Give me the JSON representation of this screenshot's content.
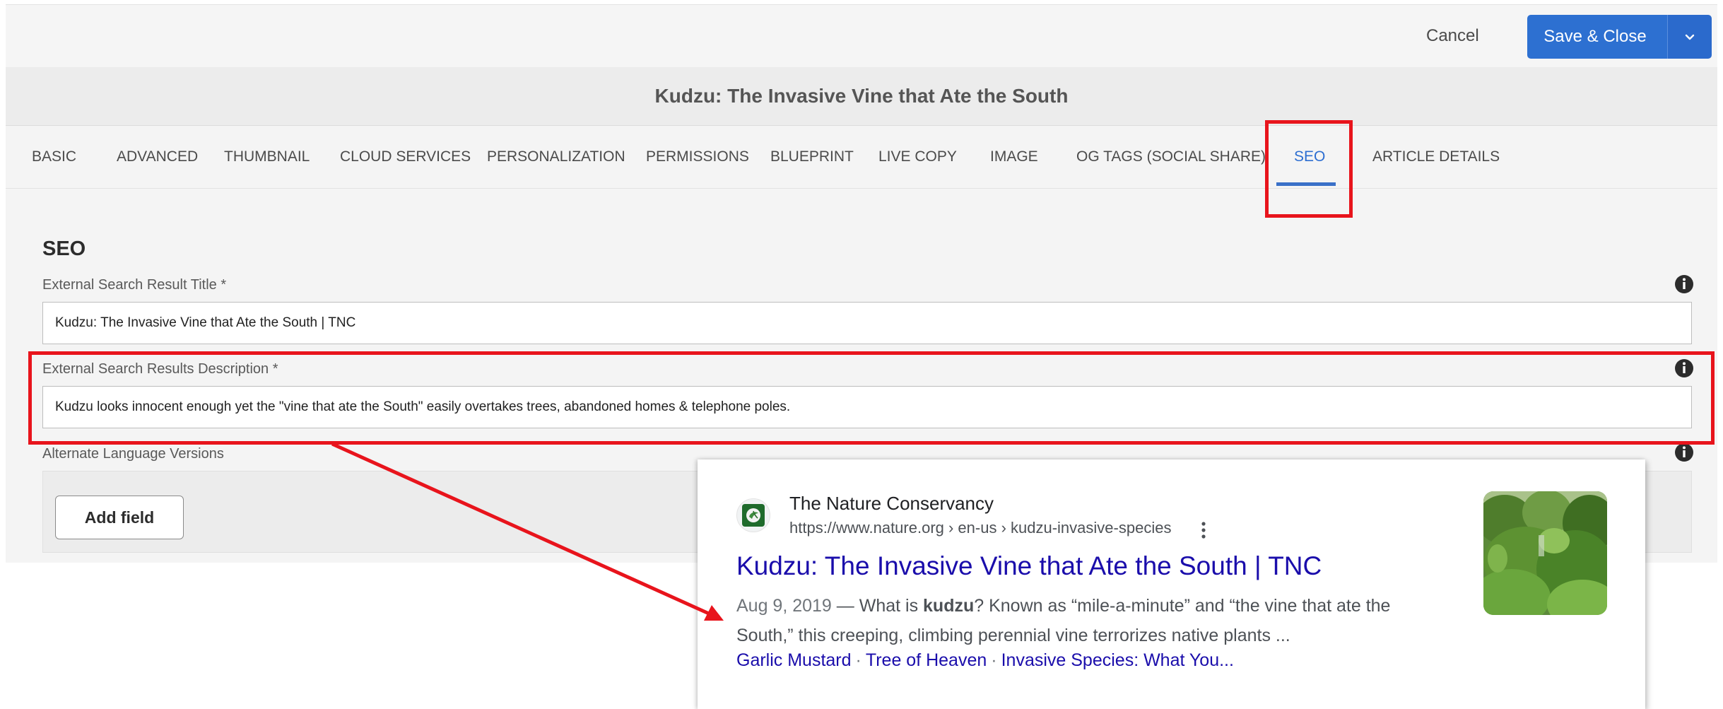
{
  "toolbar": {
    "cancel_label": "Cancel",
    "save_label": "Save & Close"
  },
  "page_title": "Kudzu: The Invasive Vine that Ate the South",
  "tabs": [
    {
      "label": "BASIC"
    },
    {
      "label": "ADVANCED"
    },
    {
      "label": "THUMBNAIL"
    },
    {
      "label": "CLOUD SERVICES"
    },
    {
      "label": "PERSONALIZATION"
    },
    {
      "label": "PERMISSIONS"
    },
    {
      "label": "BLUEPRINT"
    },
    {
      "label": "LIVE COPY"
    },
    {
      "label": "IMAGE"
    },
    {
      "label": "OG TAGS (SOCIAL SHARE)"
    },
    {
      "label": "SEO",
      "active": true
    },
    {
      "label": "ARTICLE DETAILS"
    }
  ],
  "section": {
    "title": "SEO",
    "fields": [
      {
        "label": "External Search Result Title *",
        "value": "Kudzu: The Invasive Vine that Ate the South | TNC"
      },
      {
        "label": "External Search Results Description *",
        "value": "Kudzu looks innocent enough yet the \"vine that ate the South\" easily overtakes trees, abandoned homes & telephone poles."
      }
    ],
    "alt_lang_label": "Alternate Language Versions",
    "add_field_label": "Add field"
  },
  "serp": {
    "site_name": "The Nature Conservancy",
    "url": "https://www.nature.org › en-us › kudzu-invasive-species",
    "title": "Kudzu: The Invasive Vine that Ate the South | TNC",
    "date": "Aug 9, 2019",
    "snippet_prefix": " — What is ",
    "snippet_bold": "kudzu",
    "snippet_suffix": "? Known as “mile-a-minute” and “the vine that ate the South,” this creeping, climbing perennial vine terrorizes native plants ...",
    "sitelinks": [
      "Garlic Mustard",
      "Tree of Heaven",
      "Invasive Species: What You..."
    ],
    "separator": "·"
  },
  "colors": {
    "accent": "#2d70d1",
    "highlight": "#e8141c",
    "link": "#1a0dab"
  },
  "icons": [
    "chevron-down-icon",
    "info-icon",
    "more-vert-icon",
    "favicon-icon"
  ]
}
